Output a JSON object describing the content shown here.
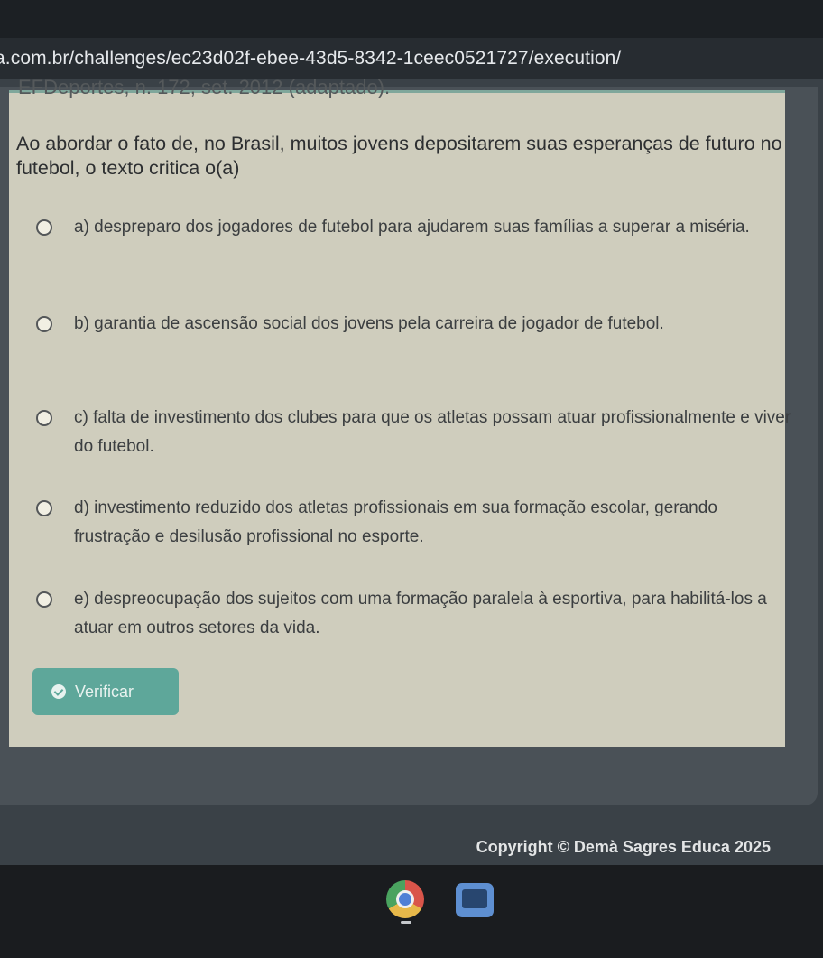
{
  "browser": {
    "url": "a.com.br/challenges/ec23d02f-ebee-43d5-8342-1ceec0521727/execution/"
  },
  "exercise": {
    "source": "EFDeportes, n. 172, set. 2012 (adaptado).",
    "question": "Ao abordar o fato de, no Brasil, muitos jovens depositarem suas esperanças de futuro no futebol, o texto critica o(a)",
    "options": [
      {
        "text": "a) despreparo dos jogadores de futebol para ajudarem suas famílias a superar a miséria."
      },
      {
        "text": "b) garantia de ascensão social dos jovens pela carreira de jogador de futebol."
      },
      {
        "text": "c) falta de investimento dos clubes para que os atletas possam atuar profissionalmente e viver do futebol."
      },
      {
        "text": "d) investimento reduzido dos atletas profissionais em sua formação escolar, gerando frustração e desilusão profissional no esporte."
      },
      {
        "text": "e) despreocupação dos sujeitos com uma formação paralela à esportiva, para habilitá-los a atuar em outros setores da vida."
      }
    ],
    "verify_label": "Verificar"
  },
  "footer": {
    "copyright": "Copyright © Demà Sagres Educa 2025"
  },
  "taskbar": {
    "apps": [
      "chrome-icon",
      "files-icon"
    ]
  },
  "colors": {
    "accent": "#5ea79a",
    "card": "#cfcdbd"
  }
}
